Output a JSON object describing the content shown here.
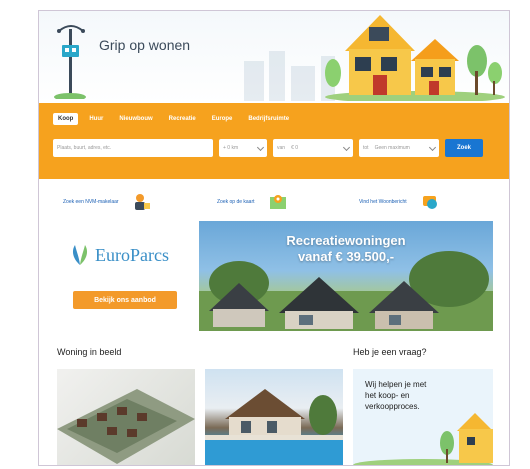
{
  "header": {
    "title": "Grip op wonen"
  },
  "search": {
    "tabs": [
      {
        "label": "Koop",
        "active": true
      },
      {
        "label": "Huur",
        "active": false
      },
      {
        "label": "Nieuwbouw",
        "active": false
      },
      {
        "label": "Recreatie",
        "active": false
      },
      {
        "label": "Europe",
        "active": false
      },
      {
        "label": "Bedrijfsruimte",
        "active": false
      }
    ],
    "location_placeholder": "Plaats, buurt, adres, etc.",
    "radius_value": "+ 0 km",
    "price_from_label": "van",
    "price_from_value": "€ 0",
    "price_to_label": "tot",
    "price_to_value": "Geen maximum",
    "submit_label": "Zoek"
  },
  "quick_links": [
    {
      "label": "Zoek een NVM-makelaar",
      "icon": "agent-icon"
    },
    {
      "label": "Zoek op de kaart",
      "icon": "map-icon"
    },
    {
      "label": "Vind het Woonbericht",
      "icon": "message-icon"
    }
  ],
  "promo": {
    "brand": "EuroParcs",
    "button_label": "Bekijk ons aanbod",
    "banner_title_line1": "Recreatiewoningen",
    "banner_title_line2": "vanaf € 39.500,-"
  },
  "sections": {
    "woning_title": "Woning in beeld",
    "vraag_title": "Heb je een vraag?",
    "help_line1": "Wij helpen je met",
    "help_line2": "het koop- en",
    "help_line3": "verkoopproces."
  },
  "colors": {
    "accent_orange": "#f6a21e",
    "button_blue": "#1976d2",
    "promo_orange": "#f39a2a"
  }
}
